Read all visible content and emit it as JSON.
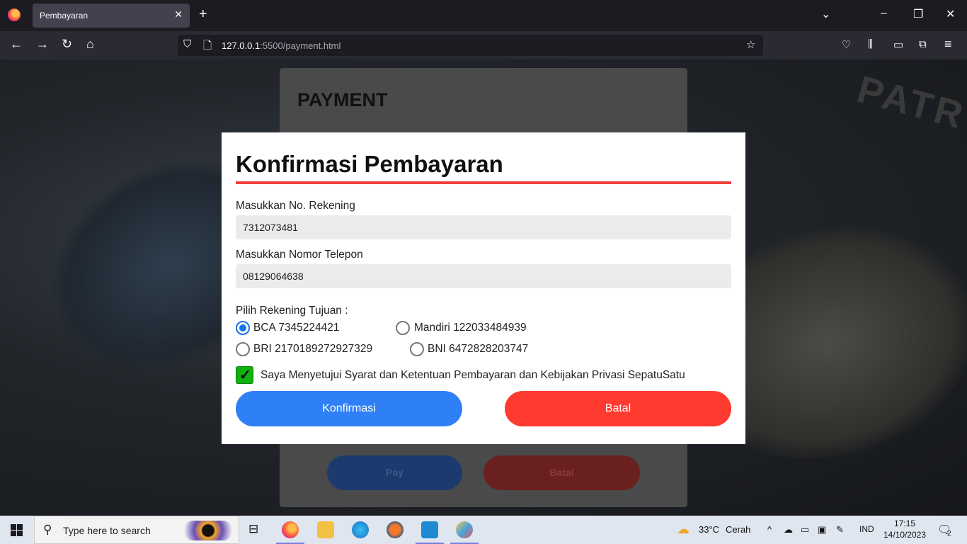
{
  "browser": {
    "tab_title": "Pembayaran",
    "url_host": "127.0.0.1",
    "url_rest": ":5500/payment.html"
  },
  "background_page": {
    "title": "PAYMENT",
    "pay_label": "Pay",
    "cancel_label": "Batal",
    "watermark": "PATR"
  },
  "modal": {
    "title": "Konfirmasi Pembayaran",
    "account_label": "Masukkan No. Rekening",
    "account_value": "7312073481",
    "phone_label": "Masukkan Nomor Telepon",
    "phone_value": "08129064638",
    "dest_label": "Pilih Rekening Tujuan :",
    "options": [
      {
        "label": "BCA 7345224421",
        "checked": true
      },
      {
        "label": "Mandiri 122033484939",
        "checked": false
      },
      {
        "label": "BRI 2170189272927329",
        "checked": false
      },
      {
        "label": "BNI 6472828203747",
        "checked": false
      }
    ],
    "agree_label": "Saya Menyetujui Syarat dan Ketentuan Pembayaran dan Kebijakan Privasi SepatuSatu",
    "confirm_label": "Konfirmasi",
    "cancel_label": "Batal"
  },
  "taskbar": {
    "search_placeholder": "Type here to search",
    "weather_temp": "33°C",
    "weather_desc": "Cerah",
    "lang": "IND",
    "time": "17:15",
    "date": "14/10/2023",
    "notif_count": "2"
  },
  "colors": {
    "accent_rule": "#f0403c",
    "confirm": "#2f80f7",
    "cancel": "#ff3b30",
    "checkbox": "#11b10d"
  }
}
